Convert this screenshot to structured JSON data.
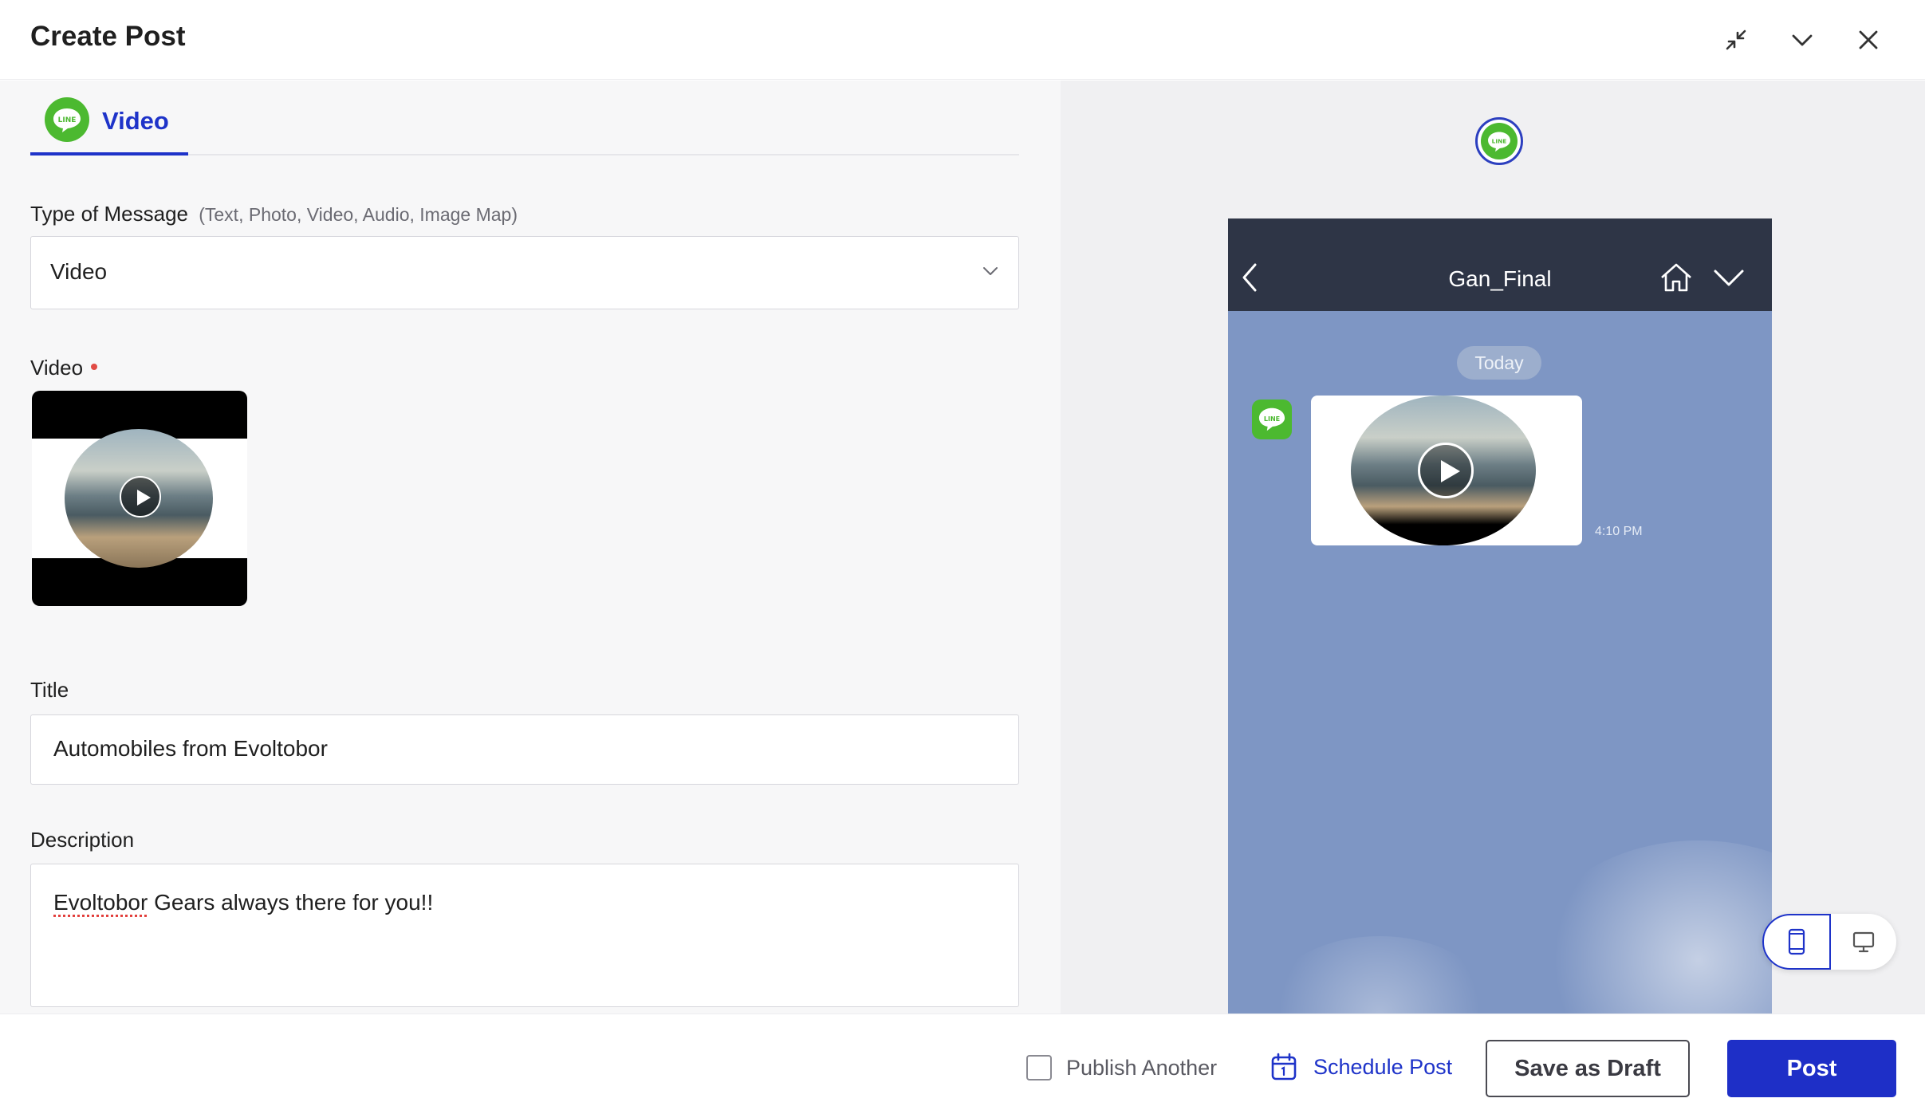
{
  "header": {
    "title": "Create Post"
  },
  "tabs": [
    {
      "label": "Video",
      "active": true,
      "icon": "line-icon"
    }
  ],
  "form": {
    "message_type": {
      "label": "Type of Message",
      "hint": "(Text, Photo, Video, Audio, Image Map)",
      "value": "Video"
    },
    "video": {
      "label": "Video",
      "required": true
    },
    "title": {
      "label": "Title",
      "value": "Automobiles from Evoltobor"
    },
    "description": {
      "label": "Description",
      "value_misspelled": "Evoltobor",
      "value_rest": " Gears always there for you!!"
    }
  },
  "preview": {
    "channel_name": "Gan_Final",
    "date_badge": "Today",
    "message_time": "4:10 PM",
    "device_mode": "mobile"
  },
  "footer": {
    "publish_another_label": "Publish Another",
    "publish_another_checked": false,
    "schedule_label": "Schedule Post",
    "save_draft_label": "Save as Draft",
    "post_label": "Post"
  },
  "colors": {
    "accent": "#1e33c9",
    "line_green": "#4cb930",
    "phone_header": "#2e3546",
    "phone_bg": "#7e96c4"
  }
}
